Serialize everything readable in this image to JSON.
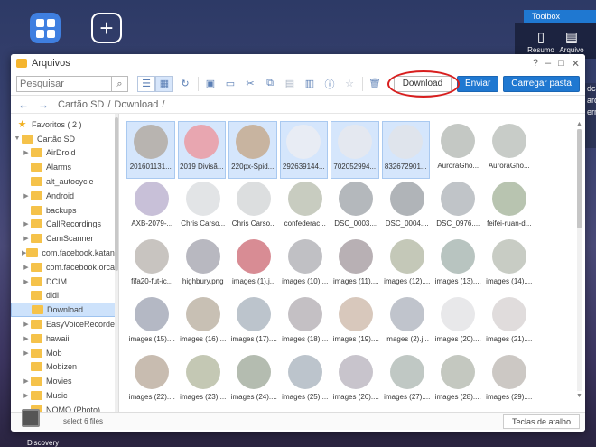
{
  "desktop": {
    "toolbox_tag": "Toolbox",
    "toolbox_items": [
      {
        "label": "Resumo",
        "icon": "phone-icon"
      },
      {
        "label": "Arquivo",
        "icon": "document-icon"
      }
    ],
    "discovery_label": "Discovery",
    "right_peek_text": "dca arqu ermi"
  },
  "window": {
    "title": "Arquivos",
    "controls": [
      "?",
      "–",
      "□",
      "✕"
    ]
  },
  "toolbar": {
    "search_placeholder": "Pesquisar",
    "download_label": "Download",
    "enviar_label": "Enviar",
    "carregar_label": "Carregar pasta"
  },
  "path": {
    "crumbs": [
      "Cartão SD",
      "/",
      "Download",
      "/"
    ]
  },
  "sidebar": {
    "favoritos": "Favoritos  ( 2 )",
    "root": "Cartão SD",
    "items": [
      {
        "label": "AirDroid",
        "caret": "▶"
      },
      {
        "label": "Alarms",
        "caret": ""
      },
      {
        "label": "alt_autocycle",
        "caret": ""
      },
      {
        "label": "Android",
        "caret": "▶"
      },
      {
        "label": "backups",
        "caret": ""
      },
      {
        "label": "CallRecordings",
        "caret": "▶"
      },
      {
        "label": "CamScanner",
        "caret": "▶"
      },
      {
        "label": "com.facebook.katana",
        "caret": "▶"
      },
      {
        "label": "com.facebook.orca",
        "caret": "▶"
      },
      {
        "label": "DCIM",
        "caret": "▶"
      },
      {
        "label": "didi",
        "caret": ""
      },
      {
        "label": "Download",
        "caret": "",
        "selected": true
      },
      {
        "label": "EasyVoiceRecorder",
        "caret": "▶"
      },
      {
        "label": "hawaii",
        "caret": "▶"
      },
      {
        "label": "Mob",
        "caret": "▶"
      },
      {
        "label": "Mobizen",
        "caret": ""
      },
      {
        "label": "Movies",
        "caret": "▶"
      },
      {
        "label": "Music",
        "caret": "▶"
      },
      {
        "label": "NOMO (Photo)",
        "caret": ""
      }
    ]
  },
  "files": [
    {
      "name": "201601131...",
      "selected": true,
      "color": "#b8b4b0"
    },
    {
      "name": "2019 Divisã...",
      "selected": true,
      "color": "#e8a6b0"
    },
    {
      "name": "220px-Spid...",
      "selected": true,
      "color": "#c8b4a0"
    },
    {
      "name": "292639144...",
      "selected": true,
      "color": "#e8ecf4"
    },
    {
      "name": "702052994...",
      "selected": true,
      "color": "#e4e8f0"
    },
    {
      "name": "832672901...",
      "selected": true,
      "color": "#dfe4ec"
    },
    {
      "name": "AuroraGho...",
      "selected": false,
      "color": "#c4c8c4"
    },
    {
      "name": "AuroraGho...",
      "selected": false,
      "color": "#c8ccc8"
    },
    {
      "name": "AXB-2079-...",
      "selected": false,
      "color": "#c8c0d8"
    },
    {
      "name": "Chris Carso...",
      "selected": false,
      "color": "#e2e4e6"
    },
    {
      "name": "Chris Carso...",
      "selected": false,
      "color": "#dcdedf"
    },
    {
      "name": "confederac...",
      "selected": false,
      "color": "#c8ccc0"
    },
    {
      "name": "DSC_0003....",
      "selected": false,
      "color": "#b4b8bc"
    },
    {
      "name": "DSC_0004....",
      "selected": false,
      "color": "#b0b4b8"
    },
    {
      "name": "DSC_0976....",
      "selected": false,
      "color": "#c0c4c8"
    },
    {
      "name": "feifei-ruan-d...",
      "selected": false,
      "color": "#b8c4b0"
    },
    {
      "name": "fifa20-fut-ic...",
      "selected": false,
      "color": "#c8c4c0"
    },
    {
      "name": "highbury.png",
      "selected": false,
      "color": "#b8b8c0"
    },
    {
      "name": "images (1).j...",
      "selected": false,
      "color": "#d88c94"
    },
    {
      "name": "images (10)....",
      "selected": false,
      "color": "#c0c0c4"
    },
    {
      "name": "images (11)....",
      "selected": false,
      "color": "#b8b0b4"
    },
    {
      "name": "images (12)....",
      "selected": false,
      "color": "#c4c8b8"
    },
    {
      "name": "images (13)....",
      "selected": false,
      "color": "#b8c4c0"
    },
    {
      "name": "images (14)....",
      "selected": false,
      "color": "#c8ccc4"
    },
    {
      "name": "images (15)....",
      "selected": false,
      "color": "#b4b8c4"
    },
    {
      "name": "images (16)....",
      "selected": false,
      "color": "#c8c0b4"
    },
    {
      "name": "images (17)....",
      "selected": false,
      "color": "#bcc4cc"
    },
    {
      "name": "images (18)....",
      "selected": false,
      "color": "#c4c0c4"
    },
    {
      "name": "images (19)....",
      "selected": false,
      "color": "#d8c8bc"
    },
    {
      "name": "images (2).j...",
      "selected": false,
      "color": "#c0c4cc"
    },
    {
      "name": "images (20)....",
      "selected": false,
      "color": "#e8e8ea"
    },
    {
      "name": "images (21)....",
      "selected": false,
      "color": "#e0dcdc"
    },
    {
      "name": "images (22)....",
      "selected": false,
      "color": "#c8bcb0"
    },
    {
      "name": "images (23)....",
      "selected": false,
      "color": "#c4c8b4"
    },
    {
      "name": "images (24)....",
      "selected": false,
      "color": "#b4bcb0"
    },
    {
      "name": "images (25)....",
      "selected": false,
      "color": "#bcc4cc"
    },
    {
      "name": "images (26)....",
      "selected": false,
      "color": "#c8c4cc"
    },
    {
      "name": "images (27)....",
      "selected": false,
      "color": "#c0c8c4"
    },
    {
      "name": "images (28)....",
      "selected": false,
      "color": "#c4c8c0"
    },
    {
      "name": "images (29)....",
      "selected": false,
      "color": "#ccc8c4"
    }
  ],
  "status": {
    "text": "select 6 files",
    "shortcut_label": "Teclas de atalho"
  }
}
